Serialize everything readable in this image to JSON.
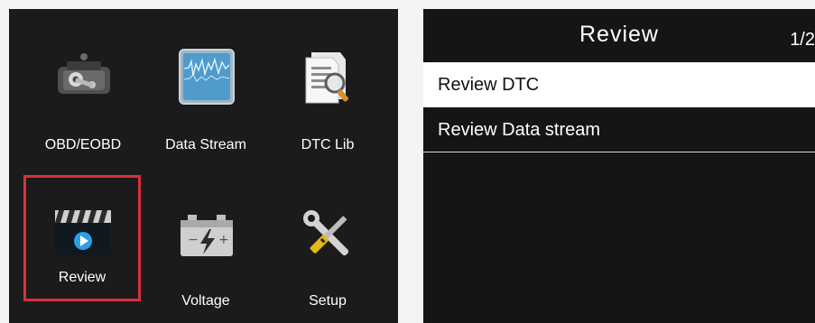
{
  "main_menu": {
    "items": [
      {
        "label": "OBD/EOBD",
        "icon": "engine-icon"
      },
      {
        "label": "Data Stream",
        "icon": "waveform-icon"
      },
      {
        "label": "DTC Lib",
        "icon": "document-search-icon"
      },
      {
        "label": "Review",
        "icon": "play-video-icon",
        "selected": true
      },
      {
        "label": "Voltage",
        "icon": "battery-icon"
      },
      {
        "label": "Setup",
        "icon": "wrench-screwdriver-icon"
      }
    ]
  },
  "review_menu": {
    "title": "Review",
    "page": "1/2",
    "items": [
      {
        "label": "Review DTC",
        "selected": true
      },
      {
        "label": "Review Data stream",
        "selected": false
      }
    ]
  },
  "colors": {
    "selection_border": "#d8313a",
    "screen_background": "#1b1b1b",
    "highlight_row": "#ffffff"
  }
}
